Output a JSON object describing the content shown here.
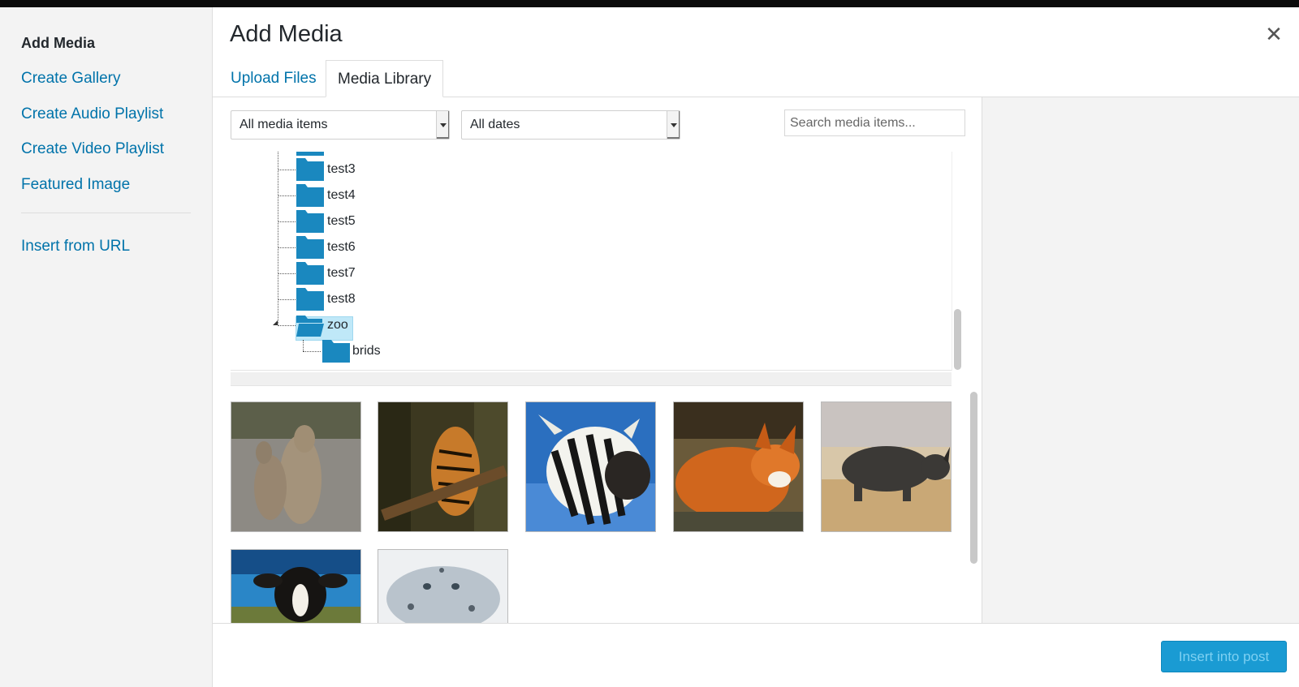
{
  "menu": {
    "title": "Add Media",
    "links": [
      "Create Gallery",
      "Create Audio Playlist",
      "Create Video Playlist",
      "Featured Image"
    ],
    "insert_url": "Insert from URL"
  },
  "frame": {
    "title": "Add Media",
    "close_glyph": "✕",
    "tabs": [
      "Upload Files",
      "Media Library"
    ]
  },
  "filters": {
    "media_type": "All media items",
    "dates": "All dates",
    "search_placeholder": "Search media items..."
  },
  "tree": {
    "folders": [
      "test3",
      "test4",
      "test5",
      "test6",
      "test7",
      "test8",
      "zoo"
    ],
    "selected": "zoo",
    "child": "brids"
  },
  "grid": {
    "images": [
      "kangaroo",
      "tiger",
      "zebra",
      "fox",
      "rhino",
      "cow",
      "snow leopard"
    ]
  },
  "toolbar": {
    "insert_label": "Insert into post"
  },
  "colors": {
    "accent": "#0073aa",
    "folder": "#1a88bf",
    "button": "#1a9bd3"
  }
}
